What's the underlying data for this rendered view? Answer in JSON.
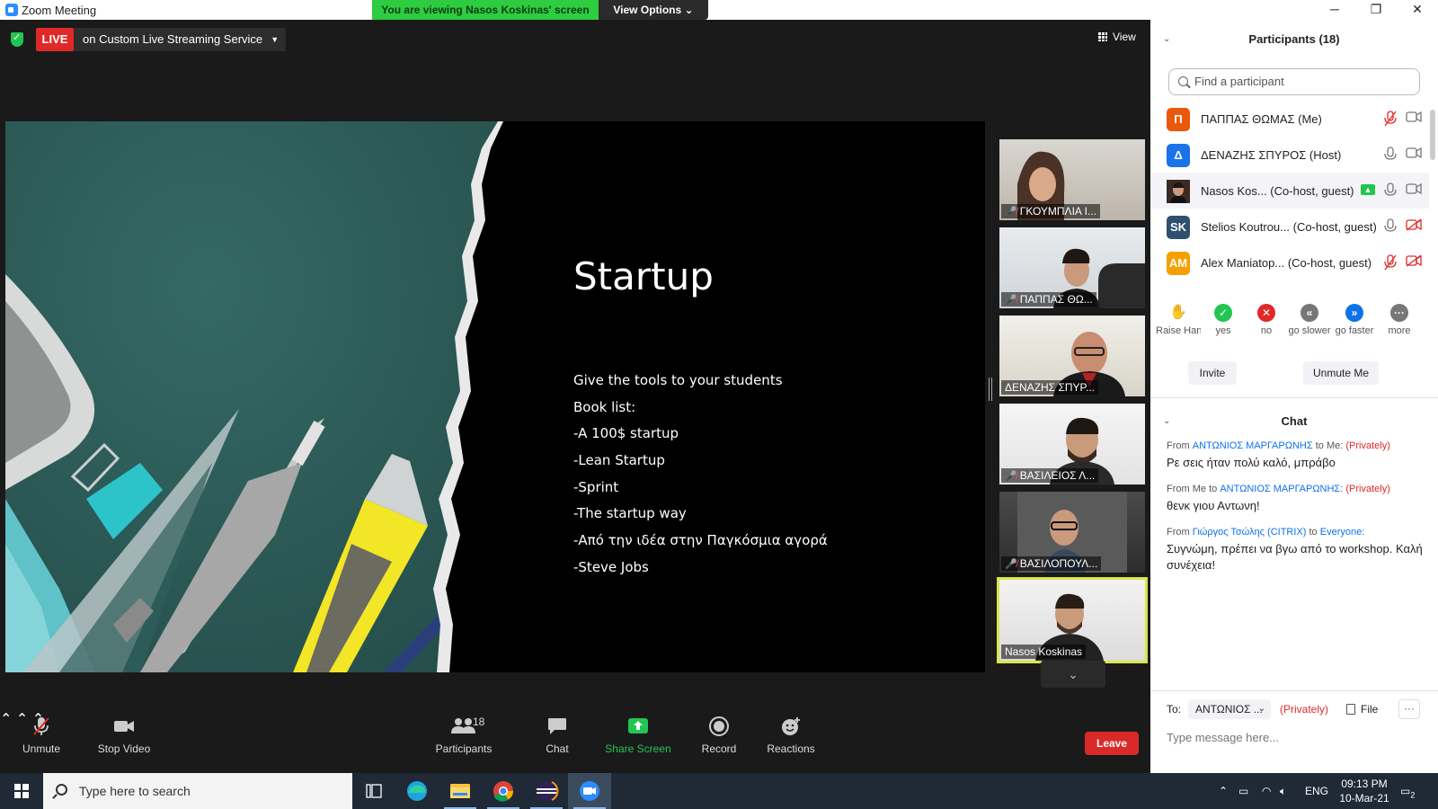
{
  "window": {
    "title": "Zoom Meeting",
    "viewing_banner": "You are viewing Nasos Koskinas' screen",
    "view_options": "View Options"
  },
  "meeting": {
    "live_label": "LIVE",
    "live_service": "on Custom Live Streaming Service",
    "view_label": "View"
  },
  "slide": {
    "title": "Startup",
    "lines": [
      "Give the tools to your students",
      "Book list:",
      "-A 100$ startup",
      "-Lean Startup",
      "-Sprint",
      "-The startup way",
      "-Από την ιδέα στην  Παγκόσμια αγορά",
      "-Steve Jobs"
    ]
  },
  "thumbnails": [
    {
      "name": "ΓΚΟΥΜΠΛΙΑ Ι...",
      "muted": true
    },
    {
      "name": "ΠΑΠΠΑΣ ΘΩ...",
      "muted": true
    },
    {
      "name": "ΔΕΝΑΖΗΣ ΣΠΥΡ...",
      "muted": false
    },
    {
      "name": "ΒΑΣΙΛΕΙΟΣ Λ...",
      "muted": true
    },
    {
      "name": "ΒΑΣΙΛΟΠΟΥΛ...",
      "muted": true
    },
    {
      "name": "Nasos Koskinas",
      "muted": false,
      "active": true
    }
  ],
  "toolbar": {
    "unmute": "Unmute",
    "stop_video": "Stop Video",
    "participants": "Participants",
    "participants_count": "18",
    "chat": "Chat",
    "share_screen": "Share Screen",
    "record": "Record",
    "reactions": "Reactions",
    "leave": "Leave"
  },
  "participants_panel": {
    "title": "Participants (18)",
    "search_placeholder": "Find a participant",
    "list": [
      {
        "initial": "Π",
        "name": "ΠΑΠΠΑΣ ΘΩΜΑΣ (Me)",
        "color": "#e8590c",
        "mic": "muted",
        "cam": "on"
      },
      {
        "initial": "Δ",
        "name": "ΔΕΝΑΖΗΣ ΣΠΥΡΟΣ (Host)",
        "color": "#1a73e8",
        "mic": "on",
        "cam": "on"
      },
      {
        "initial": "",
        "name": "Nasos Kos...  (Co-host, guest)",
        "color": "#5a3a2a",
        "mic": "on",
        "cam": "on",
        "sharing": true
      },
      {
        "initial": "SK",
        "name": "Stelios Koutrou...  (Co-host, guest)",
        "color": "#2f4f6f",
        "mic": "on",
        "cam": "off"
      },
      {
        "initial": "AM",
        "name": "Alex Maniatop...  (Co-host, guest)",
        "color": "#f59f00",
        "mic": "muted",
        "cam": "off"
      }
    ],
    "reactions": [
      {
        "label": "Raise Hand",
        "icon": "raise-hand-icon"
      },
      {
        "label": "yes",
        "icon": "yes-icon"
      },
      {
        "label": "no",
        "icon": "no-icon"
      },
      {
        "label": "go slower",
        "icon": "go-slower-icon"
      },
      {
        "label": "go faster",
        "icon": "go-faster-icon"
      },
      {
        "label": "more",
        "icon": "more-icon"
      }
    ],
    "invite": "Invite",
    "unmute_me": "Unmute Me"
  },
  "chat_panel": {
    "title": "Chat",
    "messages": [
      {
        "from_label": "From",
        "from": "ΑΝΤΩΝΙΟΣ ΜΑΡΓΑΡΩΝΗΣ",
        "to_label": "to",
        "to": "Me:",
        "privately": "(Privately)",
        "text": "Ρε σεις ήταν πολύ καλό, μπράβο"
      },
      {
        "from_label": "From",
        "from": "Me",
        "to_label": "to",
        "to": "ΑΝΤΩΝΙΟΣ ΜΑΡΓΑΡΩΝΗΣ:",
        "privately": "(Privately)",
        "text": "θενκ γιου Αντωνη!"
      },
      {
        "from_label": "From",
        "from": "Γιώργος Τσώλης (CITRIX)",
        "to_label": "to",
        "to": "Everyone:",
        "privately": "",
        "text": "Συγνώμη, πρέπει να βγω από το workshop. Καλή συνέχεια!"
      }
    ],
    "to_label": "To:",
    "to_value": "ΑΝΤΩΝΙΟΣ ...",
    "to_privately": "(Privately)",
    "file_label": "File",
    "more_label": "···",
    "input_placeholder": "Type message here..."
  },
  "taskbar": {
    "search_placeholder": "Type here to search",
    "lang": "ENG",
    "time": "09:13 PM",
    "date": "10-Mar-21",
    "notifications": "2"
  },
  "colors": {
    "accent": "#0e71eb",
    "live": "#e02828",
    "share_green": "#23c552",
    "active_speaker": "#d8e64a"
  }
}
